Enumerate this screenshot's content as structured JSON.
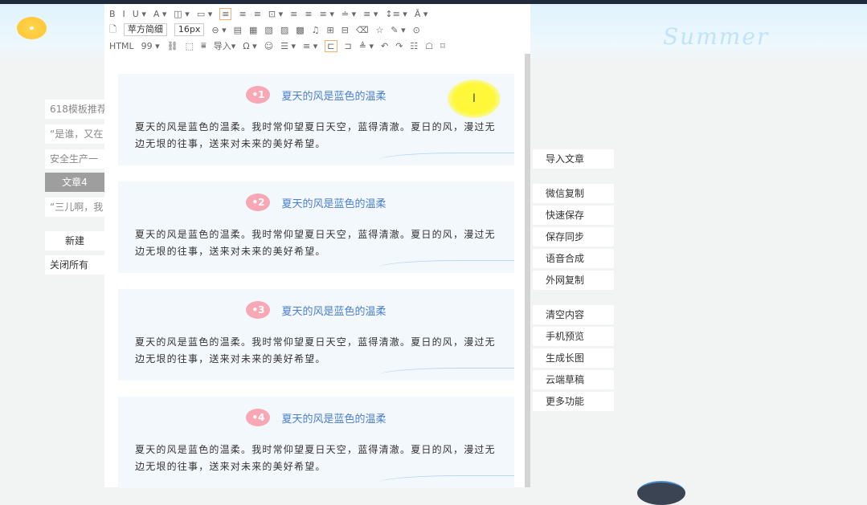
{
  "banner": {
    "summer_text": "Summer"
  },
  "toolbar": {
    "row1": [
      "B",
      "I",
      "U ▾",
      "A ▾",
      "◫ ▾",
      "▭ ▾",
      "≡",
      "≡",
      "≡",
      "⊡ ▾",
      "≡",
      "≡",
      "≡ ▾",
      "≐ ▾",
      "≡ ▾",
      "↕≡ ▾",
      "Ā ▾"
    ],
    "font_family": "苹方简细",
    "font_size": "16px",
    "row2": [
      "⊖ ▾",
      "▤",
      "▦",
      "▧",
      "▨",
      "▩",
      "♫",
      "⊞",
      "⊟",
      "⌫",
      "☆",
      "✎ ▾",
      "⊙"
    ],
    "row3": [
      "HTML",
      "99 ▾",
      "⛓",
      "⬚",
      "⩸",
      "导入▾",
      "Ω ▾",
      "☺",
      "☰ ▾",
      "≡ ▾",
      "⊏",
      "⊐",
      "≜ ▾",
      "↶",
      "↷",
      "☷",
      "☖",
      "⌑"
    ]
  },
  "articles": [
    {
      "num": "•1",
      "title": "夏天的风是蓝色的温柔",
      "body": "夏天的风是蓝色的温柔。我时常仰望夏日天空，蓝得清澈。夏日的风，漫过无边无垠的往事，送来对未来的美好希望。"
    },
    {
      "num": "•2",
      "title": "夏天的风是蓝色的温柔",
      "body": "夏天的风是蓝色的温柔。我时常仰望夏日天空，蓝得清澈。夏日的风，漫过无边无垠的往事，送来对未来的美好希望。"
    },
    {
      "num": "•3",
      "title": "夏天的风是蓝色的温柔",
      "body": "夏天的风是蓝色的温柔。我时常仰望夏日天空，蓝得清澈。夏日的风，漫过无边无垠的往事，送来对未来的美好希望。"
    },
    {
      "num": "•4",
      "title": "夏天的风是蓝色的温柔",
      "body": "夏天的风是蓝色的温柔。我时常仰望夏日天空，蓝得清澈。夏日的风，漫过无边无垠的往事，送来对未来的美好希望。"
    }
  ],
  "cursor": "I",
  "left_tabs": [
    "618模板推荐",
    "“是谁，又在",
    "安全生产一",
    "文章4",
    "“三儿啊，我"
  ],
  "left_buttons": {
    "new": "新建",
    "close_all": "关闭所有"
  },
  "right_buttons": [
    "导入文章",
    "微信复制",
    "快速保存",
    "保存同步",
    "语音合成",
    "外网复制",
    "清空内容",
    "手机预览",
    "生成长图",
    "云端草稿",
    "更多功能"
  ]
}
